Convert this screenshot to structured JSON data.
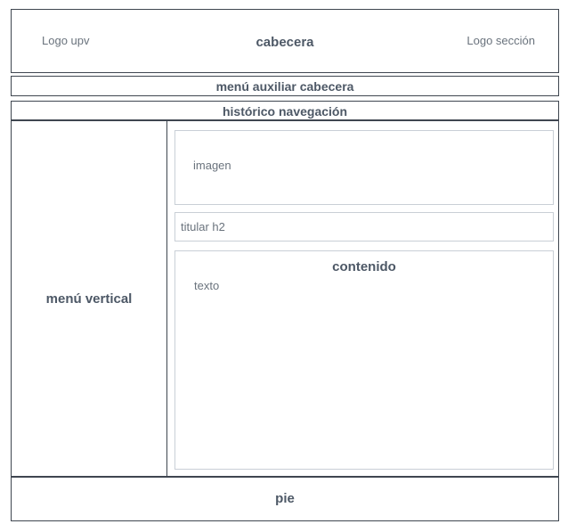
{
  "header": {
    "logo_left": "Logo upv",
    "title": "cabecera",
    "logo_right": "Logo sección"
  },
  "aux_menu": {
    "label": "menú auxiliar cabecera"
  },
  "breadcrumb": {
    "label": "histórico navegación"
  },
  "sidebar": {
    "label": "menú vertical"
  },
  "main": {
    "image_label": "imagen",
    "heading_label": "titular h2",
    "content_title": "contenido",
    "content_text": "texto"
  },
  "footer": {
    "label": "pie"
  }
}
